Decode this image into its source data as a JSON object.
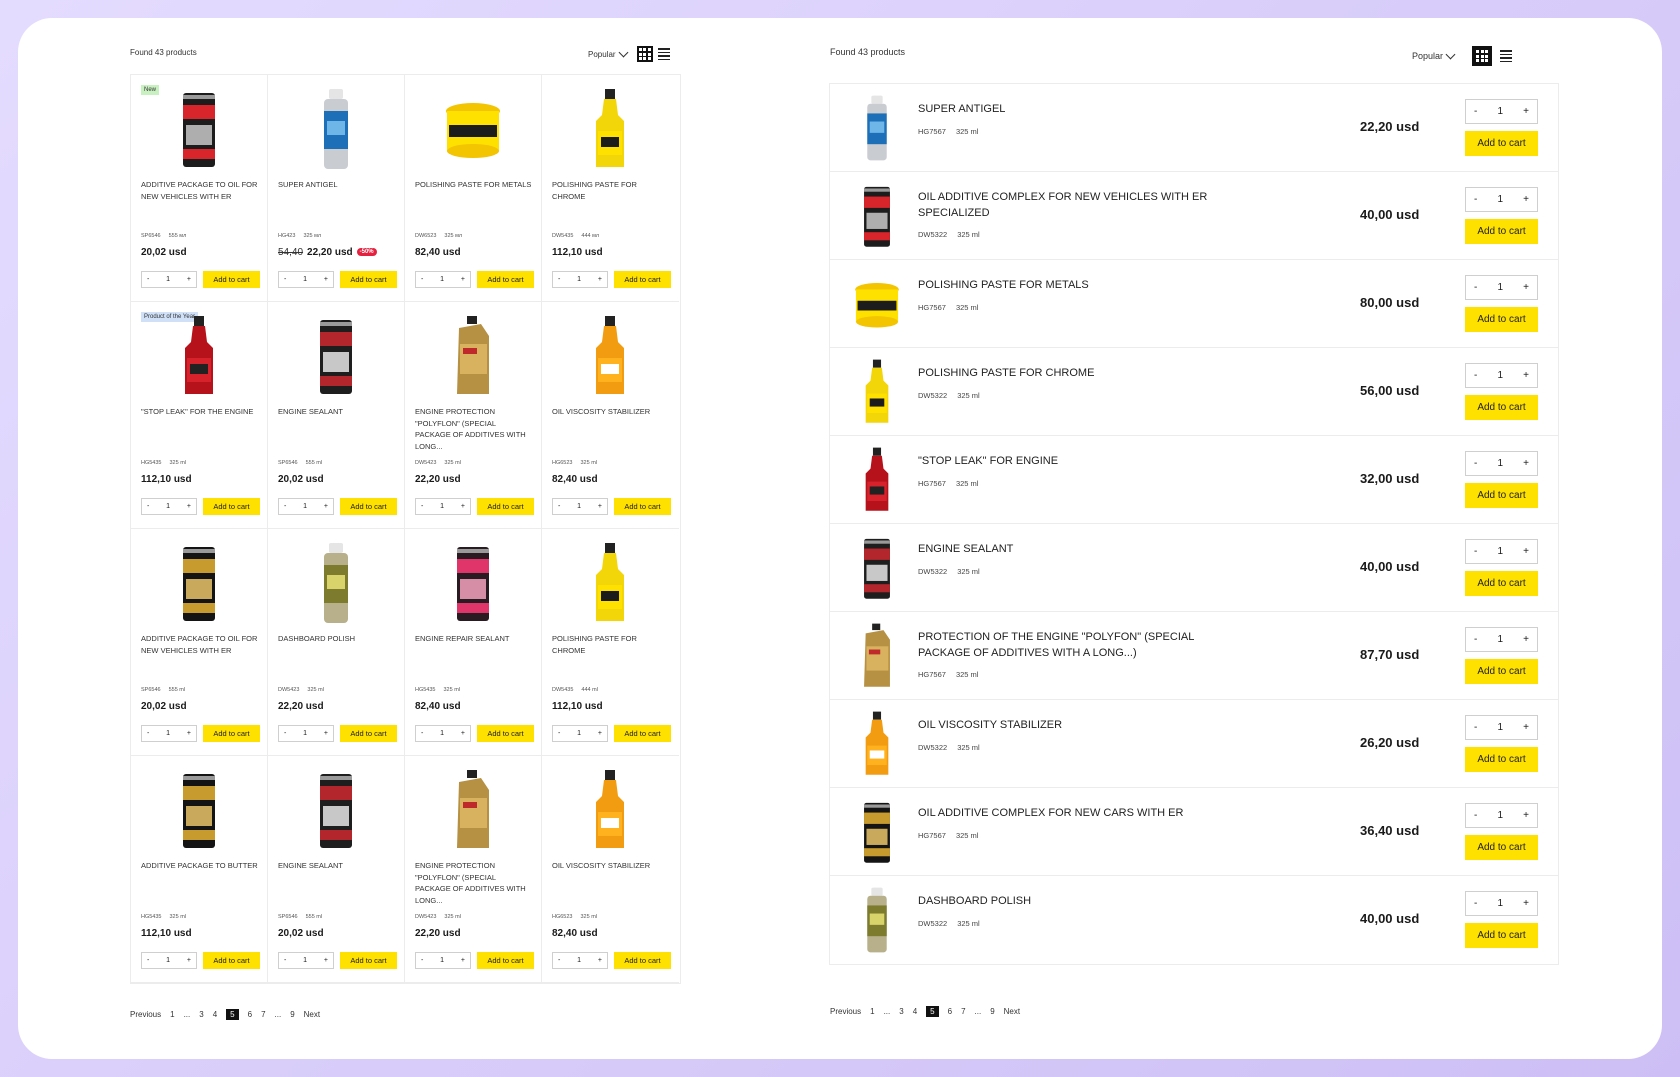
{
  "left": {
    "found": "Found 43 products",
    "sort": "Popular",
    "cards": [
      {
        "badge": "New",
        "badge_type": "new",
        "name": "ADDITIVE PACKAGE TO OIL FOR NEW VEHICLES WITH ER",
        "sku": "SP6546",
        "size": "555 мл",
        "price": "20,02 usd",
        "qty": "1",
        "add": "Add to cart",
        "img": "can-red"
      },
      {
        "name": "SUPER ANTIGEL",
        "sku": "HG423",
        "size": "325 мл",
        "old_price": "54,40",
        "price": "22,20 usd",
        "discount": "-50%",
        "qty": "1",
        "add": "Add to cart",
        "img": "spray-blue"
      },
      {
        "name": "POLISHING PASTE FOR METALS",
        "sku": "DW6523",
        "size": "325 мл",
        "price": "82,40 usd",
        "qty": "1",
        "add": "Add to cart",
        "img": "tub-yellow"
      },
      {
        "name": "POLISHING PASTE FOR CHROME",
        "sku": "DW5435",
        "size": "444 мл",
        "price": "112,10 usd",
        "qty": "1",
        "add": "Add to cart",
        "img": "bottle-yellow"
      },
      {
        "badge": "Product of the Year",
        "badge_type": "year",
        "name": "\"STOP LEAK\" FOR THE ENGINE",
        "sku": "HG5435",
        "size": "325 ml",
        "price": "112,10 usd",
        "qty": "1",
        "add": "Add to cart",
        "img": "bottle-red"
      },
      {
        "name": "ENGINE SEALANT",
        "sku": "SP6546",
        "size": "555 ml",
        "price": "20,02 usd",
        "qty": "1",
        "add": "Add to cart",
        "img": "can-darkred"
      },
      {
        "name": "ENGINE PROTECTION \"POLYFLON\" (SPECIAL PACKAGE OF ADDITIVES WITH LONG...",
        "sku": "DW5423",
        "size": "325 ml",
        "price": "22,20 usd",
        "qty": "1",
        "add": "Add to cart",
        "img": "jug-gold"
      },
      {
        "name": "OIL VISCOSITY STABILIZER",
        "sku": "HG6523",
        "size": "325 ml",
        "price": "82,40 usd",
        "qty": "1",
        "add": "Add to cart",
        "img": "bottle-orange"
      },
      {
        "name": "ADDITIVE PACKAGE TO OIL FOR NEW VEHICLES WITH ER",
        "sku": "SP6546",
        "size": "555 ml",
        "price": "20,02 usd",
        "qty": "1",
        "add": "Add to cart",
        "img": "can-black"
      },
      {
        "name": "DASHBOARD POLISH",
        "sku": "DW5423",
        "size": "325 ml",
        "price": "22,20 usd",
        "qty": "1",
        "add": "Add to cart",
        "img": "spray-olive"
      },
      {
        "name": "ENGINE REPAIR SEALANT",
        "sku": "HG5435",
        "size": "325 ml",
        "price": "82,40 usd",
        "qty": "1",
        "add": "Add to cart",
        "img": "can-pink"
      },
      {
        "name": "POLISHING PASTE FOR CHROME",
        "sku": "DW5435",
        "size": "444 ml",
        "price": "112,10 usd",
        "qty": "1",
        "add": "Add to cart",
        "img": "bottle-yellow"
      },
      {
        "name": "ADDITIVE PACKAGE TO BUTTER",
        "sku": "HG5435",
        "size": "325 ml",
        "price": "112,10 usd",
        "qty": "1",
        "add": "Add to cart",
        "img": "can-black"
      },
      {
        "name": "ENGINE SEALANT",
        "sku": "SP6546",
        "size": "555 ml",
        "price": "20,02 usd",
        "qty": "1",
        "add": "Add to cart",
        "img": "can-darkred"
      },
      {
        "name": "ENGINE PROTECTION \"POLYFLON\" (SPECIAL PACKAGE OF ADDITIVES WITH LONG...",
        "sku": "DW5423",
        "size": "325 ml",
        "price": "22,20 usd",
        "qty": "1",
        "add": "Add to cart",
        "img": "jug-gold"
      },
      {
        "name": "OIL VISCOSITY STABILIZER",
        "sku": "HG6523",
        "size": "325 ml",
        "price": "82,40 usd",
        "qty": "1",
        "add": "Add to cart",
        "img": "bottle-orange"
      }
    ],
    "pager": {
      "prev": "Previous",
      "pages": [
        "1",
        "...",
        "3",
        "4",
        "5",
        "6",
        "7",
        "...",
        "9"
      ],
      "current": "5",
      "next": "Next"
    }
  },
  "right": {
    "found": "Found 43 products",
    "sort": "Popular",
    "rows": [
      {
        "name": "SUPER ANTIGEL",
        "sku": "HG7567",
        "size": "325 ml",
        "price": "22,20 usd",
        "qty": "1",
        "add": "Add to cart",
        "img": "spray-blue"
      },
      {
        "name": "OIL ADDITIVE COMPLEX FOR NEW VEHICLES WITH ER SPECIALIZED",
        "sku": "DW5322",
        "size": "325 ml",
        "price": "40,00 usd",
        "qty": "1",
        "add": "Add to cart",
        "img": "can-red"
      },
      {
        "name": "POLISHING PASTE FOR METALS",
        "sku": "HG7567",
        "size": "325 ml",
        "price": "80,00 usd",
        "qty": "1",
        "add": "Add to cart",
        "img": "tub-yellow"
      },
      {
        "name": "POLISHING PASTE FOR CHROME",
        "sku": "DW5322",
        "size": "325 ml",
        "price": "56,00 usd",
        "qty": "1",
        "add": "Add to cart",
        "img": "bottle-yellow"
      },
      {
        "name": "\"STOP LEAK\" FOR ENGINE",
        "sku": "HG7567",
        "size": "325 ml",
        "price": "32,00 usd",
        "qty": "1",
        "add": "Add to cart",
        "img": "bottle-red"
      },
      {
        "name": "ENGINE SEALANT",
        "sku": "DW5322",
        "size": "325 ml",
        "price": "40,00 usd",
        "qty": "1",
        "add": "Add to cart",
        "img": "can-darkred"
      },
      {
        "name": "PROTECTION OF THE ENGINE \"POLYFON\" (SPECIAL PACKAGE OF ADDITIVES WITH A LONG...)",
        "sku": "HG7567",
        "size": "325 ml",
        "price": "87,70 usd",
        "qty": "1",
        "add": "Add to cart",
        "img": "jug-gold"
      },
      {
        "name": "OIL VISCOSITY STABILIZER",
        "sku": "DW5322",
        "size": "325 ml",
        "price": "26,20 usd",
        "qty": "1",
        "add": "Add to cart",
        "img": "bottle-orange"
      },
      {
        "name": "OIL ADDITIVE COMPLEX FOR NEW CARS WITH ER",
        "sku": "HG7567",
        "size": "325 ml",
        "price": "36,40 usd",
        "qty": "1",
        "add": "Add to cart",
        "img": "can-black"
      },
      {
        "name": "DASHBOARD POLISH",
        "sku": "DW5322",
        "size": "325 ml",
        "price": "40,00 usd",
        "qty": "1",
        "add": "Add to cart",
        "img": "spray-olive"
      }
    ],
    "pager": {
      "prev": "Previous",
      "pages": [
        "1",
        "...",
        "3",
        "4",
        "5",
        "6",
        "7",
        "...",
        "9"
      ],
      "current": "5",
      "next": "Next"
    }
  },
  "colors": {
    "accent": "#ffe100",
    "discount": "#e6213f",
    "active": "#111111",
    "frame_bg": "#d8cdfb"
  }
}
